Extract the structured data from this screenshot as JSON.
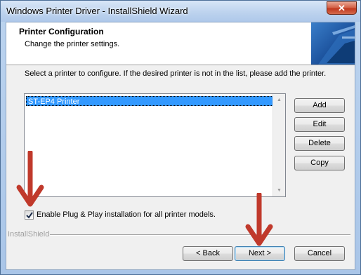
{
  "window": {
    "title": "Windows Printer Driver - InstallShield Wizard",
    "close_label": "✕"
  },
  "header": {
    "title": "Printer Configuration",
    "subtitle": "Change the printer settings."
  },
  "instruction": "Select a printer to configure. If the desired printer is not in the list, please add the printer.",
  "printer_list": {
    "items": [
      {
        "label": "ST-EP4 Printer",
        "selected": true
      }
    ]
  },
  "side_buttons": {
    "add": "Add",
    "edit": "Edit",
    "delete": "Delete",
    "copy": "Copy"
  },
  "plug_and_play": {
    "label": "Enable Plug & Play installation for all printer models.",
    "checked": true
  },
  "footer": {
    "brand": "InstallShield",
    "back": "< Back",
    "next": "Next >",
    "cancel": "Cancel"
  },
  "annotation_color": "#c0392b"
}
